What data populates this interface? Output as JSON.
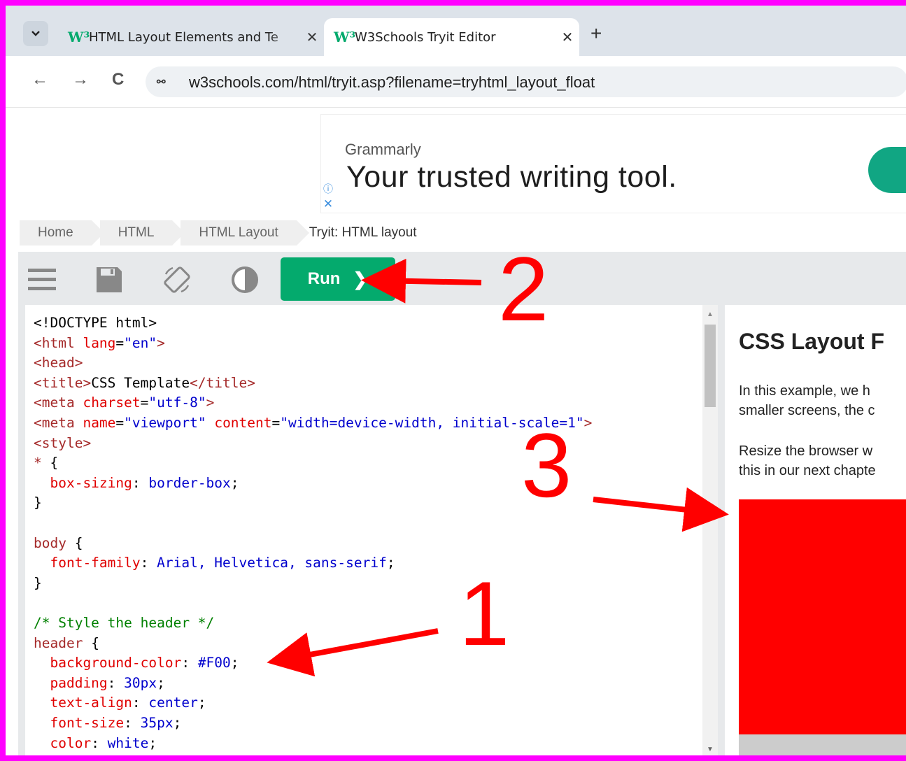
{
  "browser": {
    "tabs": [
      {
        "title": "HTML Layout Elements and Te",
        "active": false
      },
      {
        "title": "W3Schools Tryit Editor",
        "active": true
      }
    ],
    "favicon": "W³",
    "address": "w3schools.com/html/tryit.asp?filename=tryhtml_layout_float",
    "close_glyph": "✕",
    "new_tab_glyph": "+",
    "back_glyph": "←",
    "forward_glyph": "→",
    "reload_glyph": "C",
    "site_info_glyph": "⚯"
  },
  "ad": {
    "brand": "Grammarly",
    "headline": "Your trusted writing tool.",
    "info_glyph": "ⓘ",
    "close_glyph": "✕",
    "cta_color": "#11a683"
  },
  "breadcrumb": [
    "Home",
    "HTML",
    "HTML Layout",
    "Tryit: HTML layout"
  ],
  "toolbar": {
    "run_label": "Run",
    "run_chevron": "❯",
    "run_color": "#04aa6d"
  },
  "code_lines": [
    [
      {
        "c": "t-plain",
        "t": "<!DOCTYPE html>"
      }
    ],
    [
      {
        "c": "t-tag",
        "t": "<html "
      },
      {
        "c": "t-attr",
        "t": "lang"
      },
      {
        "c": "t-plain",
        "t": "="
      },
      {
        "c": "t-val",
        "t": "\"en\""
      },
      {
        "c": "t-tag",
        "t": ">"
      }
    ],
    [
      {
        "c": "t-tag",
        "t": "<head>"
      }
    ],
    [
      {
        "c": "t-tag",
        "t": "<title>"
      },
      {
        "c": "t-plain",
        "t": "CSS Template"
      },
      {
        "c": "t-tag",
        "t": "</title>"
      }
    ],
    [
      {
        "c": "t-tag",
        "t": "<meta "
      },
      {
        "c": "t-attr",
        "t": "charset"
      },
      {
        "c": "t-plain",
        "t": "="
      },
      {
        "c": "t-val",
        "t": "\"utf-8\""
      },
      {
        "c": "t-tag",
        "t": ">"
      }
    ],
    [
      {
        "c": "t-tag",
        "t": "<meta "
      },
      {
        "c": "t-attr",
        "t": "name"
      },
      {
        "c": "t-plain",
        "t": "="
      },
      {
        "c": "t-val",
        "t": "\"viewport\""
      },
      {
        "c": "t-plain",
        "t": " "
      },
      {
        "c": "t-attr",
        "t": "content"
      },
      {
        "c": "t-plain",
        "t": "="
      },
      {
        "c": "t-val",
        "t": "\"width=device-width, initial-scale=1\""
      },
      {
        "c": "t-tag",
        "t": ">"
      }
    ],
    [
      {
        "c": "t-tag",
        "t": "<style>"
      }
    ],
    [
      {
        "c": "t-tag",
        "t": "* "
      },
      {
        "c": "t-plain",
        "t": "{"
      }
    ],
    [
      {
        "c": "t-plain",
        "t": "  "
      },
      {
        "c": "t-prop",
        "t": "box-sizing"
      },
      {
        "c": "t-plain",
        "t": ": "
      },
      {
        "c": "t-val",
        "t": "border-box"
      },
      {
        "c": "t-plain",
        "t": ";"
      }
    ],
    [
      {
        "c": "t-plain",
        "t": "}"
      }
    ],
    [
      {
        "c": "t-plain",
        "t": ""
      }
    ],
    [
      {
        "c": "t-tag",
        "t": "body "
      },
      {
        "c": "t-plain",
        "t": "{"
      }
    ],
    [
      {
        "c": "t-plain",
        "t": "  "
      },
      {
        "c": "t-prop",
        "t": "font-family"
      },
      {
        "c": "t-plain",
        "t": ": "
      },
      {
        "c": "t-val",
        "t": "Arial, Helvetica, sans-serif"
      },
      {
        "c": "t-plain",
        "t": ";"
      }
    ],
    [
      {
        "c": "t-plain",
        "t": "}"
      }
    ],
    [
      {
        "c": "t-plain",
        "t": ""
      }
    ],
    [
      {
        "c": "t-cmt",
        "t": "/* Style the header */"
      }
    ],
    [
      {
        "c": "t-tag",
        "t": "header "
      },
      {
        "c": "t-plain",
        "t": "{"
      }
    ],
    [
      {
        "c": "t-plain",
        "t": "  "
      },
      {
        "c": "t-prop",
        "t": "background-color"
      },
      {
        "c": "t-plain",
        "t": ": "
      },
      {
        "c": "t-val",
        "t": "#F00"
      },
      {
        "c": "t-plain",
        "t": ";"
      }
    ],
    [
      {
        "c": "t-plain",
        "t": "  "
      },
      {
        "c": "t-prop",
        "t": "padding"
      },
      {
        "c": "t-plain",
        "t": ": "
      },
      {
        "c": "t-val",
        "t": "30px"
      },
      {
        "c": "t-plain",
        "t": ";"
      }
    ],
    [
      {
        "c": "t-plain",
        "t": "  "
      },
      {
        "c": "t-prop",
        "t": "text-align"
      },
      {
        "c": "t-plain",
        "t": ": "
      },
      {
        "c": "t-val",
        "t": "center"
      },
      {
        "c": "t-plain",
        "t": ";"
      }
    ],
    [
      {
        "c": "t-plain",
        "t": "  "
      },
      {
        "c": "t-prop",
        "t": "font-size"
      },
      {
        "c": "t-plain",
        "t": ": "
      },
      {
        "c": "t-val",
        "t": "35px"
      },
      {
        "c": "t-plain",
        "t": ";"
      }
    ],
    [
      {
        "c": "t-plain",
        "t": "  "
      },
      {
        "c": "t-prop",
        "t": "color"
      },
      {
        "c": "t-plain",
        "t": ": "
      },
      {
        "c": "t-val",
        "t": "white"
      },
      {
        "c": "t-plain",
        "t": ";"
      }
    ]
  ],
  "result": {
    "title": "CSS Layout F",
    "paragraph1": [
      "In this example, we h",
      "smaller screens, the c"
    ],
    "paragraph2": [
      "Resize the browser w",
      "this in our next chapte"
    ],
    "header_color": "#ff0000"
  },
  "annotations": {
    "labels": [
      "1",
      "2",
      "3"
    ],
    "color": "#ff0000",
    "border_color": "#ff00ff"
  }
}
